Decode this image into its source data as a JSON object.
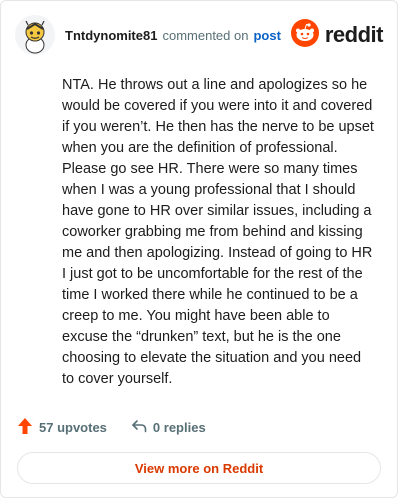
{
  "header": {
    "username": "Tntdynomite81",
    "commented_text": "commented on",
    "post_link": "post",
    "brand_word": "reddit"
  },
  "comment": {
    "text": "NTA. He throws out a line and apologizes so he would be covered if you were into it and covered if you weren’t. He then has the nerve to be upset when you are the definition of professional. Please go see HR. There were so many times when I was a young professional that I should have gone to HR over similar issues, including a coworker grabbing me from behind and kissing me and then apologizing. Instead of going to HR I just got to be uncomfortable for the rest of the time I worked there while he continued to be a creep to me. You might have been able to excuse the “drunken” text, but he is the one choosing to elevate the situation and you need to cover yourself."
  },
  "actions": {
    "upvotes": "57 upvotes",
    "replies": "0 replies"
  },
  "footer": {
    "view_more": "View more on Reddit"
  },
  "colors": {
    "reddit_orange": "#ff4500",
    "link_blue": "#0a62c6",
    "view_more_text": "#d93900"
  },
  "icons": {
    "avatar": "snoo-avatar-icon",
    "brand": "reddit-logo-icon",
    "upvote": "upvote-arrow-icon",
    "reply": "reply-arrow-icon"
  }
}
